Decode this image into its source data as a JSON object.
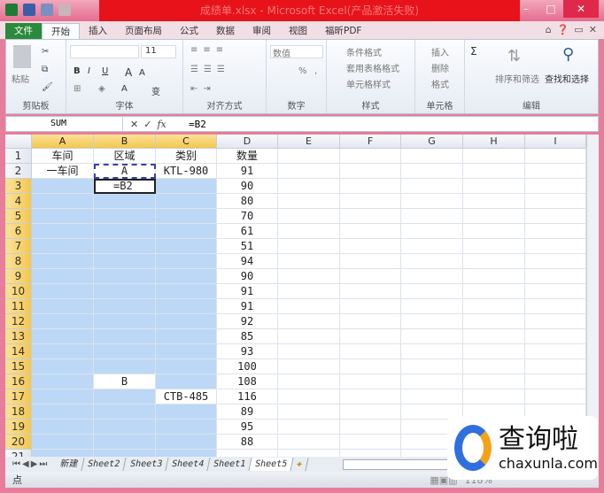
{
  "window": {
    "title": "成绩单.xlsx - Microsoft Excel(产品激活失败)",
    "minimize": "–",
    "maximize": "□",
    "close": "✕"
  },
  "ribbon_tabs": [
    "文件",
    "开始",
    "插入",
    "页面布局",
    "公式",
    "数据",
    "审阅",
    "视图",
    "福昕PDF"
  ],
  "ribbon": {
    "clipboard": {
      "label": "剪贴板",
      "paste": "粘贴"
    },
    "font": {
      "label": "字体",
      "size": "11",
      "bold": "B",
      "italic": "I",
      "underline": "U",
      "grow": "A",
      "shrink": "A",
      "color": "A",
      "phonetic": "变"
    },
    "alignment": {
      "label": "对齐方式"
    },
    "number": {
      "label": "数字",
      "format": "数值",
      "percent": "%",
      "comma": ","
    },
    "styles": {
      "label": "样式",
      "conditional": "条件格式",
      "table": "套用表格格式",
      "cell": "单元格样式"
    },
    "cells": {
      "label": "单元格",
      "insert": "插入",
      "delete": "删除",
      "format": "格式"
    },
    "editing": {
      "label": "编辑",
      "sum": "Σ",
      "sort": "排序和筛选",
      "find": "查找和选择"
    }
  },
  "formula_bar": {
    "name_box": "SUM",
    "cancel": "✕",
    "enter": "✓",
    "fx": "fx",
    "value": "=B2"
  },
  "columns": [
    "A",
    "B",
    "C",
    "D",
    "E",
    "F",
    "G",
    "H",
    "I"
  ],
  "rows": [
    [
      "车间",
      "区域",
      "类别",
      "数量"
    ],
    [
      "一车间",
      "A",
      "KTL-980",
      "91"
    ],
    [
      "",
      "=B2",
      "",
      "90"
    ],
    [
      "",
      "",
      "",
      "80"
    ],
    [
      "",
      "",
      "",
      "70"
    ],
    [
      "",
      "",
      "",
      "61"
    ],
    [
      "",
      "",
      "",
      "51"
    ],
    [
      "",
      "",
      "",
      "94"
    ],
    [
      "",
      "",
      "",
      "90"
    ],
    [
      "",
      "",
      "",
      "91"
    ],
    [
      "",
      "",
      "",
      "91"
    ],
    [
      "",
      "",
      "",
      "92"
    ],
    [
      "",
      "",
      "",
      "85"
    ],
    [
      "",
      "",
      "",
      "93"
    ],
    [
      "",
      "",
      "",
      "100"
    ],
    [
      "",
      "B",
      "",
      "108"
    ],
    [
      "",
      "",
      "CTB-485",
      "116"
    ],
    [
      "",
      "",
      "",
      "89"
    ],
    [
      "",
      "",
      "",
      "95"
    ],
    [
      "",
      "",
      "",
      "88"
    ]
  ],
  "sheet_tabs": [
    "新建",
    "Sheet2",
    "Sheet3",
    "Sheet4",
    "Sheet1",
    "Sheet5"
  ],
  "active_sheet": "Sheet5",
  "status": {
    "mode": "点",
    "zoom": "118%"
  },
  "watermark": {
    "brand": "查询啦",
    "url": "chaxunla.com"
  },
  "colors": {
    "selection": "#bcd8f6",
    "title_band": "#e8121a",
    "file_tab": "#2c8a3c"
  }
}
